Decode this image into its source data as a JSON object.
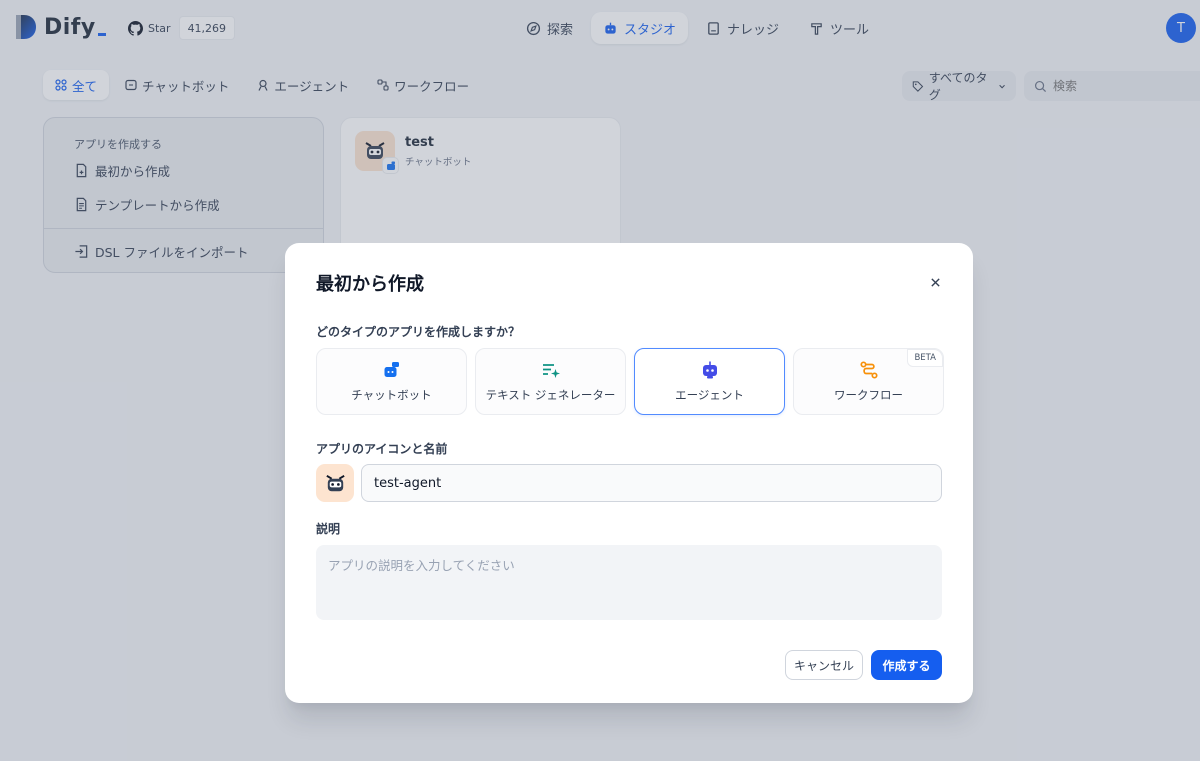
{
  "header": {
    "logo_text": "Dify",
    "star_label": "Star",
    "star_count": "41,269",
    "nav": [
      {
        "label": "探索",
        "icon": "compass-icon"
      },
      {
        "label": "スタジオ",
        "icon": "robot-icon",
        "active": true
      },
      {
        "label": "ナレッジ",
        "icon": "book-icon"
      },
      {
        "label": "ツール",
        "icon": "hammer-icon"
      }
    ],
    "avatar_initial": "T"
  },
  "filters": {
    "items": [
      {
        "label": "全て",
        "icon": "grid-icon",
        "active": true
      },
      {
        "label": "チャットボット",
        "icon": "chat-bubble-icon"
      },
      {
        "label": "エージェント",
        "icon": "agent-icon"
      },
      {
        "label": "ワークフロー",
        "icon": "workflow-icon"
      }
    ],
    "tag_filter_label": "すべてのタグ",
    "search_placeholder": "検索"
  },
  "create_card": {
    "title": "アプリを作成する",
    "items": [
      {
        "label": "最初から作成",
        "icon": "file-plus-icon"
      },
      {
        "label": "テンプレートから作成",
        "icon": "file-text-icon"
      },
      {
        "label": "DSL ファイルをインポート",
        "icon": "import-icon"
      }
    ]
  },
  "apps": [
    {
      "name": "test",
      "type": "チャットボット",
      "icon": "robot-face-icon"
    }
  ],
  "modal": {
    "title": "最初から作成",
    "type_question": "どのタイプのアプリを作成しますか？",
    "types": [
      {
        "label": "チャットボット",
        "icon": "chatbot-icon",
        "color": "#1570ef"
      },
      {
        "label": "テキスト ジェネレーター",
        "icon": "text-generator-icon",
        "color": "#0e9384"
      },
      {
        "label": "エージェント",
        "icon": "agent-robot-icon",
        "color": "#444ce7",
        "selected": true
      },
      {
        "label": "ワークフロー",
        "icon": "workflow-route-icon",
        "color": "#f79009",
        "badge": "BETA"
      }
    ],
    "name_label": "アプリのアイコンと名前",
    "name_value": "test-agent",
    "description_label": "説明",
    "description_placeholder": "アプリの説明を入力してください",
    "cancel_label": "キャンセル",
    "create_label": "作成する"
  },
  "colors": {
    "accent": "#155eef",
    "icon_bg": "#fde4d0"
  }
}
